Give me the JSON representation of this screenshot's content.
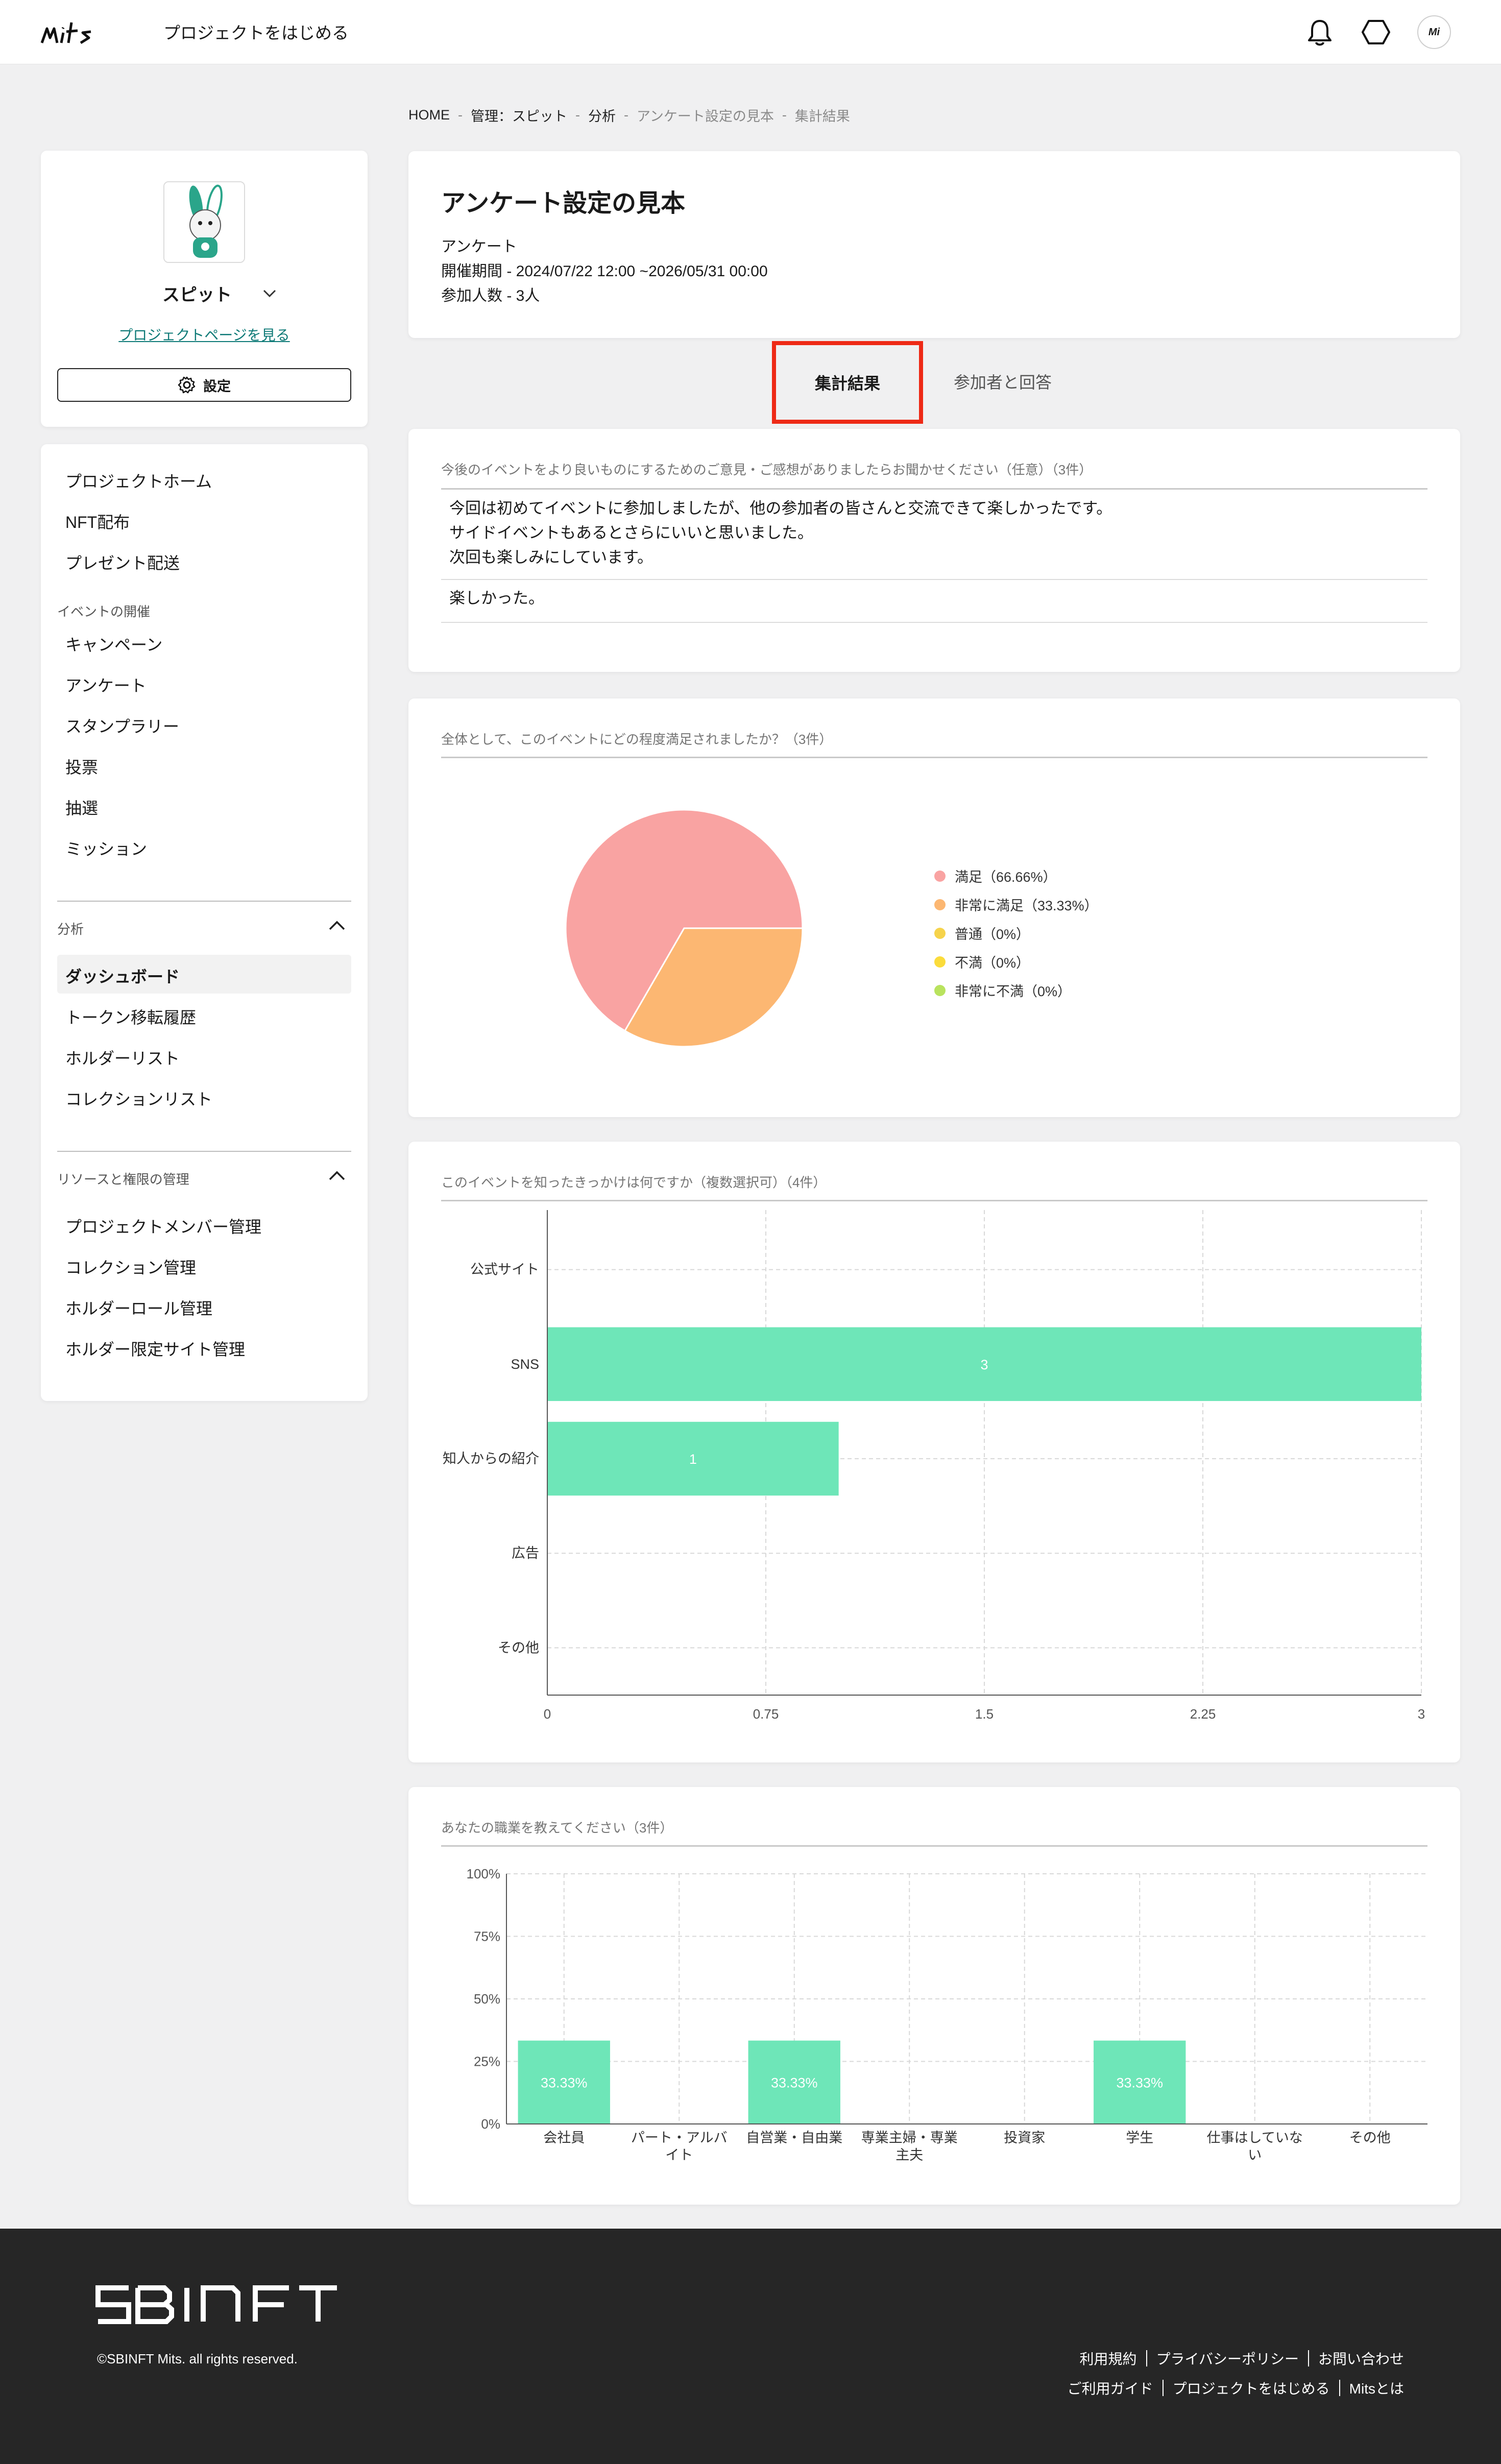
{
  "header": {
    "start_project": "プロジェクトをはじめる",
    "avatar_text": "Mi"
  },
  "breadcrumb": [
    "HOME",
    "管理：スピット",
    "分析",
    "アンケート設定の見本",
    "集計結果"
  ],
  "project": {
    "name": "スピット",
    "page_link": "プロジェクトページを見る",
    "settings_label": "設定"
  },
  "nav": {
    "items_top": [
      "プロジェクトホーム",
      "NFT配布",
      "プレゼント配送"
    ],
    "events_section": "イベントの開催",
    "events": [
      "キャンペーン",
      "アンケート",
      "スタンプラリー",
      "投票",
      "抽選",
      "ミッション"
    ],
    "analysis_section": "分析",
    "analysis": [
      "ダッシュボード",
      "トークン移転履歴",
      "ホルダーリスト",
      "コレクションリスト"
    ],
    "resources_section": "リソースと権限の管理",
    "resources": [
      "プロジェクトメンバー管理",
      "コレクション管理",
      "ホルダーロール管理",
      "ホルダー限定サイト管理"
    ]
  },
  "survey": {
    "title": "アンケート設定の見本",
    "type": "アンケート",
    "period": "開催期間 - 2024/07/22 12:00 ~2026/05/31 00:00",
    "participants": "参加人数 - 3人"
  },
  "tabs": {
    "results": "集計結果",
    "participants": "参加者と回答"
  },
  "q_feedback": {
    "title": "今後のイベントをより良いものにするためのご意見・ご感想がありましたらお聞かせください（任意）（3件）",
    "answers": [
      "今回は初めてイベントに参加しましたが、他の参加者の皆さんと交流できて楽しかったです。\nサイドイベントもあるとさらにいいと思いました。\n次回も楽しみにしています。",
      "楽しかった。"
    ]
  },
  "q_satisfaction": {
    "title": "全体として、このイベントにどの程度満足されましたか？（3件）"
  },
  "q_source": {
    "title": "このイベントを知ったきっかけは何ですか（複数選択可）（4件）"
  },
  "q_job": {
    "title": "あなたの職業を教えてください（3件）"
  },
  "colors": {
    "pie": [
      "#f9a3a2",
      "#fcb772",
      "#f6d34b",
      "#fbdc3b",
      "#b9e35e"
    ],
    "bar": "#6ee6b8",
    "accent_link": "#0e7a77",
    "highlight": "#ee2a16"
  },
  "chart_data": [
    {
      "type": "pie",
      "title": "全体として、このイベントにどの程度満足されましたか？（3件）",
      "legend_position": "right",
      "slices": [
        {
          "label": "満足（66.66%）",
          "value": 66.66
        },
        {
          "label": "非常に満足（33.33%）",
          "value": 33.33
        },
        {
          "label": "普通（0%）",
          "value": 0
        },
        {
          "label": "不満（0%）",
          "value": 0
        },
        {
          "label": "非常に不満（0%）",
          "value": 0
        }
      ]
    },
    {
      "type": "bar",
      "orientation": "horizontal",
      "title": "このイベントを知ったきっかけは何ですか（複数選択可）（4件）",
      "categories": [
        "公式サイト",
        "SNS",
        "知人からの紹介",
        "広告",
        "その他"
      ],
      "values": [
        0,
        3,
        1,
        0,
        0
      ],
      "xlim": [
        0,
        3
      ],
      "xticks": [
        "0",
        "0.75",
        "1.5",
        "2.25",
        "3"
      ],
      "grid": true
    },
    {
      "type": "bar",
      "title": "あなたの職業を教えてください（3件）",
      "categories": [
        "会社員",
        "パート・アルバイト",
        "自営業・自由業",
        "専業主婦・専業主夫",
        "投資家",
        "学生",
        "仕事はしていない",
        "その他"
      ],
      "category_lines": [
        [
          "会社員"
        ],
        [
          "パート・アルバ",
          "イト"
        ],
        [
          "自営業・自由業"
        ],
        [
          "専業主婦・専業",
          "主夫"
        ],
        [
          "投資家"
        ],
        [
          "学生"
        ],
        [
          "仕事はしていな",
          "い"
        ],
        [
          "その他"
        ]
      ],
      "values": [
        33.33,
        0,
        33.33,
        0,
        0,
        33.33,
        0,
        0
      ],
      "value_labels": [
        "33.33%",
        "",
        "33.33%",
        "",
        "",
        "33.33%",
        "",
        ""
      ],
      "ylim": [
        0,
        100
      ],
      "yticks": [
        "0%",
        "25%",
        "50%",
        "75%",
        "100%"
      ],
      "grid": true
    }
  ],
  "footer": {
    "copyright": "©SBINFT Mits. all rights reserved.",
    "links_row1": [
      "利用規約",
      "プライバシーポリシー",
      "お問い合わせ"
    ],
    "links_row2": [
      "ご利用ガイド",
      "プロジェクトをはじめる",
      "Mitsとは"
    ]
  }
}
